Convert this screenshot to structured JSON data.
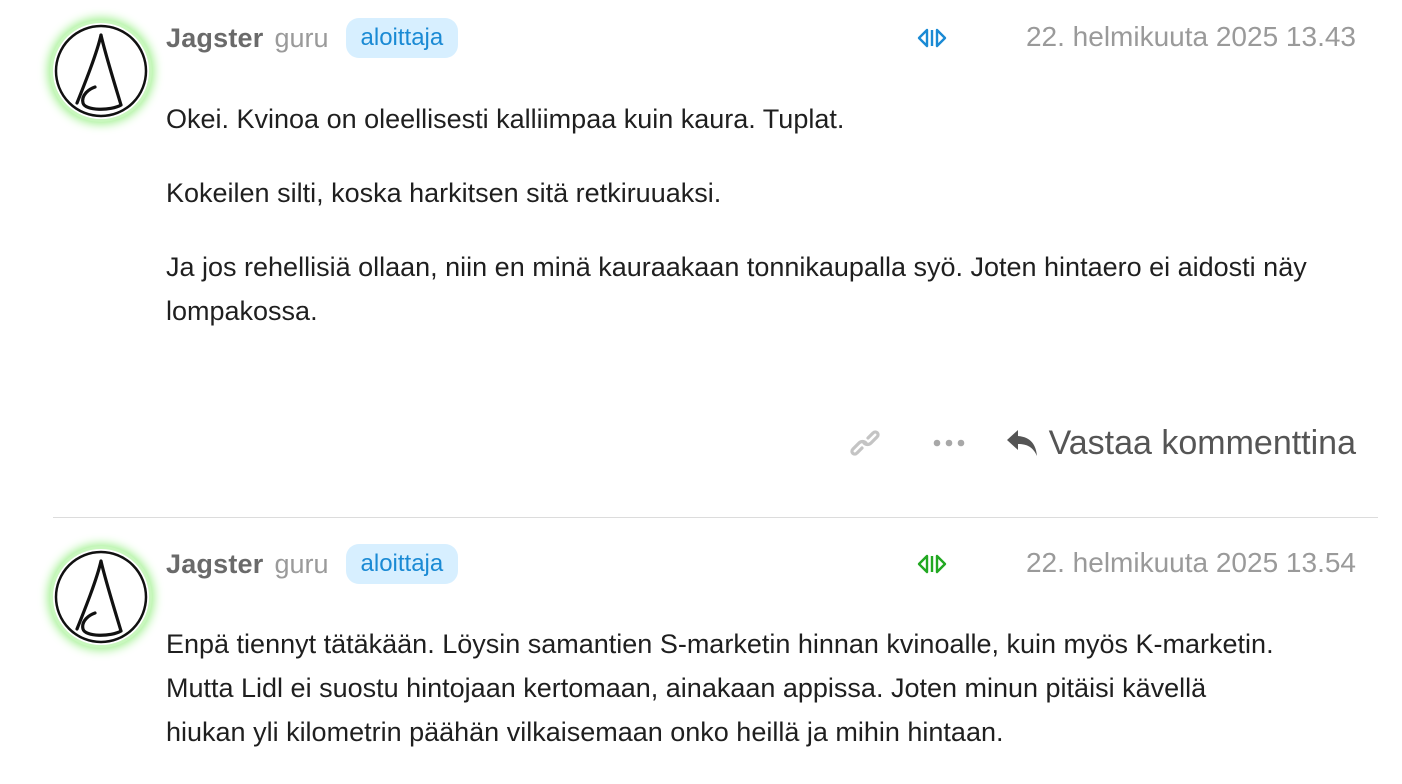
{
  "posts": [
    {
      "author": "Jagster",
      "rank": "guru",
      "badge": "aloittaja",
      "timestamp": "22. helmikuuta 2025 13.43",
      "vote_color": "#1a8ad4",
      "paragraphs": [
        "Okei. Kvinoa on oleellisesti kalliimpaa kuin kaura. Tuplat.",
        "Kokeilen silti, koska harkitsen sitä retkiruuaksi.",
        "Ja jos rehellisiä ollaan, niin en minä kauraakaan tonnikaupalla syö. Joten hintaero ei aidosti näy lompakossa."
      ],
      "actions": {
        "reply_label": "Vastaa kommenttina"
      }
    },
    {
      "author": "Jagster",
      "rank": "guru",
      "badge": "aloittaja",
      "timestamp": "22. helmikuuta 2025 13.54",
      "vote_color": "#22a822",
      "paragraphs": [
        "Enpä tiennyt tätäkään. Löysin samantien S-marketin hinnan kvinoalle, kuin myös K-marketin. Mutta Lidl ei suostu hintojaan kertomaan, ainakaan appissa. Joten minun pitäisi kävellä hiukan yli kilometrin päähän vilkaisemaan onko heillä ja mihin hintaan."
      ]
    }
  ]
}
